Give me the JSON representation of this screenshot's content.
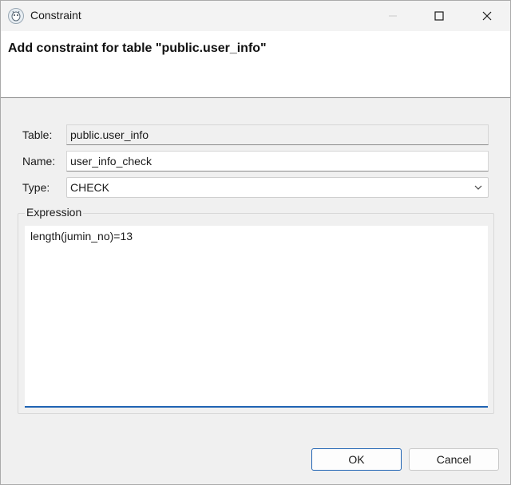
{
  "window": {
    "title": "Constraint",
    "controls": [
      "minimize-icon",
      "maximize-icon",
      "close-icon"
    ]
  },
  "header": {
    "title": "Add constraint for table \"public.user_info\""
  },
  "form": {
    "table_label": "Table:",
    "table_value": "public.user_info",
    "name_label": "Name:",
    "name_value": "user_info_check",
    "type_label": "Type:",
    "type_value": "CHECK"
  },
  "expression": {
    "group_label": "Expression",
    "value": "length(jumin_no)=13"
  },
  "buttons": {
    "ok_label": "OK",
    "cancel_label": "Cancel"
  },
  "colors": {
    "accent": "#1f63b3",
    "dialog_bg": "#f0f0f0"
  }
}
